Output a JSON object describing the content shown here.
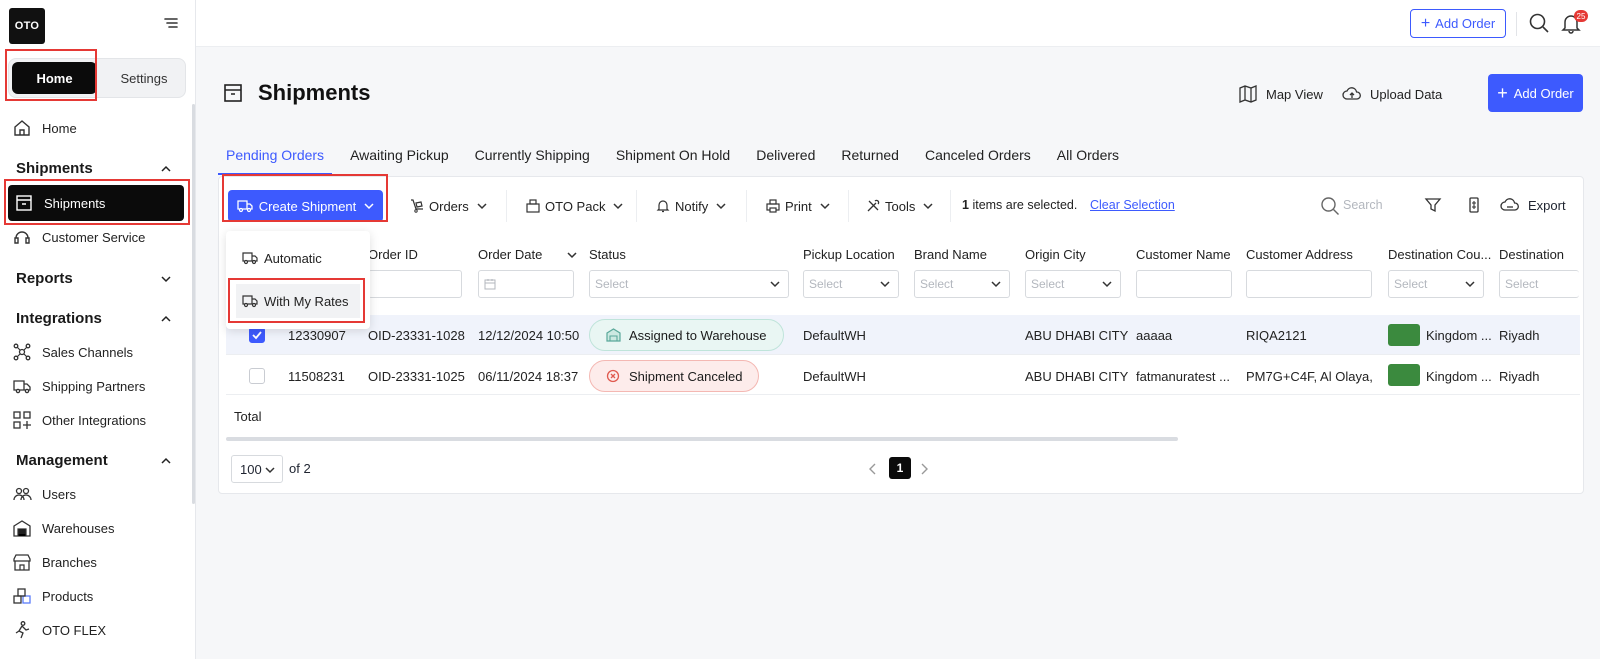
{
  "logo": {
    "text": "OTO"
  },
  "sidebar": {
    "top_toggle": {
      "home": "Home",
      "settings": "Settings"
    },
    "home_item": "Home",
    "sections": {
      "shipments": "Shipments",
      "reports": "Reports",
      "integrations": "Integrations",
      "management": "Management"
    },
    "items": {
      "shipments": "Shipments",
      "customer_service": "Customer Service",
      "sales_channels": "Sales Channels",
      "shipping_partners": "Shipping Partners",
      "other_integrations": "Other Integrations",
      "users": "Users",
      "warehouses": "Warehouses",
      "branches": "Branches",
      "products": "Products",
      "oto_flex": "OTO FLEX"
    }
  },
  "topbar": {
    "add_order": "Add Order",
    "notification_count": "25"
  },
  "header": {
    "title": "Shipments",
    "map_view": "Map View",
    "upload_data": "Upload Data",
    "add_order": "Add Order"
  },
  "tabs": [
    "Pending Orders",
    "Awaiting Pickup",
    "Currently Shipping",
    "Shipment On Hold",
    "Delivered",
    "Returned",
    "Canceled Orders",
    "All Orders"
  ],
  "toolbar": {
    "create_shipment": "Create Shipment",
    "orders": "Orders",
    "oto_pack": "OTO Pack",
    "notify": "Notify",
    "print": "Print",
    "tools": "Tools",
    "selected_count": "1",
    "selected_suffix": "items are selected.",
    "clear_selection": "Clear Selection",
    "search_placeholder": "Search",
    "export": "Export"
  },
  "create_menu": {
    "automatic": "Automatic",
    "with_my_rates": "With My Rates"
  },
  "table": {
    "columns": {
      "order_id": "Order ID",
      "order_date": "Order Date",
      "status": "Status",
      "pickup_location": "Pickup Location",
      "brand_name": "Brand Name",
      "origin_city": "Origin City",
      "customer_name": "Customer Name",
      "customer_address": "Customer Address",
      "destination_country": "Destination Cou...",
      "destination_city": "Destination"
    },
    "select_placeholder": "Select",
    "rows": [
      {
        "id": "12330907",
        "order_id": "OID-23331-1028",
        "date": "12/12/2024 10:50",
        "status": "Assigned to Warehouse",
        "pickup": "DefaultWH",
        "brand": "",
        "origin": "ABU DHABI CITY",
        "customer": "aaaaa",
        "address": "RIQA2121",
        "country": "Kingdom ...",
        "city": "Riyadh",
        "selected": true
      },
      {
        "id": "11508231",
        "order_id": "OID-23331-1025",
        "date": "06/11/2024 18:37",
        "status": "Shipment Canceled",
        "pickup": "DefaultWH",
        "brand": "",
        "origin": "ABU DHABI CITY",
        "customer": "fatmanuratest ...",
        "address": "PM7G+C4F, Al Olaya, ...",
        "country": "Kingdom ...",
        "city": "Riyadh",
        "selected": false
      }
    ],
    "total_label": "Total"
  },
  "pagination": {
    "per_page": "100",
    "of_pages": "of 2",
    "current": "1"
  },
  "colors": {
    "primary": "#3d5afe",
    "highlight": "#e53935"
  }
}
